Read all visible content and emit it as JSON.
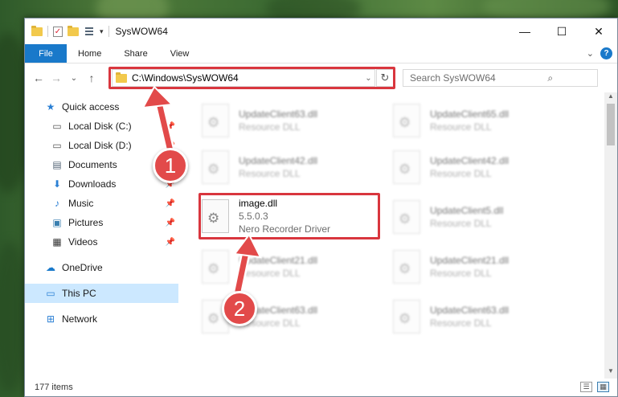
{
  "window": {
    "title": "SysWOW64",
    "controls": {
      "minimize": "—",
      "maximize": "☐",
      "close": "✕"
    }
  },
  "ribbon": {
    "file_tab": "File",
    "tabs": [
      "Home",
      "Share",
      "View"
    ],
    "expand": "⌄",
    "help": "?"
  },
  "navigation": {
    "back": "←",
    "forward": "→",
    "recent": "⌄",
    "up": "↑",
    "address": "C:\\Windows\\SysWOW64",
    "address_dropdown": "⌄",
    "refresh": "↻",
    "search_placeholder": "Search SysWOW64",
    "search_icon": "⌕"
  },
  "sidebar": {
    "items": [
      {
        "label": "Quick access",
        "icon": "★",
        "pinned": false
      },
      {
        "label": "Local Disk (C:)",
        "icon": "▭",
        "pinned": true
      },
      {
        "label": "Local Disk (D:)",
        "icon": "▭",
        "pinned": true
      },
      {
        "label": "Documents",
        "icon": "▤",
        "pinned": true
      },
      {
        "label": "Downloads",
        "icon": "⬇",
        "pinned": true
      },
      {
        "label": "Music",
        "icon": "♪",
        "pinned": true
      },
      {
        "label": "Pictures",
        "icon": "▣",
        "pinned": true
      },
      {
        "label": "Videos",
        "icon": "▦",
        "pinned": true
      },
      {
        "label": "OneDrive",
        "icon": "☁",
        "pinned": false
      },
      {
        "label": "This PC",
        "icon": "▭",
        "pinned": false,
        "selected": true
      },
      {
        "label": "Network",
        "icon": "⊞",
        "pinned": false
      }
    ],
    "pin_glyph": "📌"
  },
  "files": [
    {
      "name": "UpdateClient63.dll",
      "type": "Resource DLL",
      "blurred": true
    },
    {
      "name": "UpdateClient65.dll",
      "type": "Resource DLL",
      "blurred": true
    },
    {
      "name": "UpdateClient42.dll",
      "type": "Resource DLL",
      "blurred": true
    },
    {
      "name": "UpdateClient42.dll",
      "type": "Resource DLL",
      "blurred": true
    },
    {
      "name": "image.dll",
      "version": "5.5.0.3",
      "type": "Nero Recorder Driver",
      "blurred": false
    },
    {
      "name": "UpdateClient5.dll",
      "type": "Resource DLL",
      "blurred": true
    },
    {
      "name": "UpdateClient21.dll",
      "type": "Resource DLL",
      "blurred": true
    },
    {
      "name": "UpdateClient21.dll",
      "type": "Resource DLL",
      "blurred": true
    },
    {
      "name": "UpdateClient63.dll",
      "type": "Resource DLL",
      "blurred": true
    },
    {
      "name": "UpdateClient63.dll",
      "type": "Resource DLL",
      "blurred": true
    }
  ],
  "status": {
    "count": "177 items"
  },
  "callouts": [
    "1",
    "2"
  ],
  "colors": {
    "accent": "#1979ca",
    "highlight": "#d9363e",
    "callout": "#e24a4a",
    "selected": "#cce8ff"
  }
}
